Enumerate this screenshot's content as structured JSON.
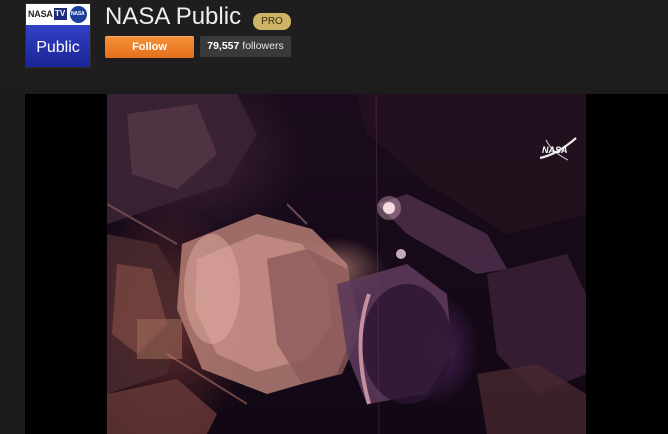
{
  "channel": {
    "name": "NASA Public",
    "badge": "PRO",
    "follow_label": "Follow",
    "followers_count": "79,557",
    "followers_label": "followers"
  },
  "logo": {
    "top_text": "NASA",
    "tv_text": "TV",
    "meatball_text": "NASA",
    "bottom_text": "Public",
    "bottom_color": "#2a36b8"
  },
  "video": {
    "watermark": "NASA"
  },
  "colors": {
    "background": "#1c1c1c",
    "follow_button": "#f0832a",
    "pro_badge": "#cdb466"
  }
}
